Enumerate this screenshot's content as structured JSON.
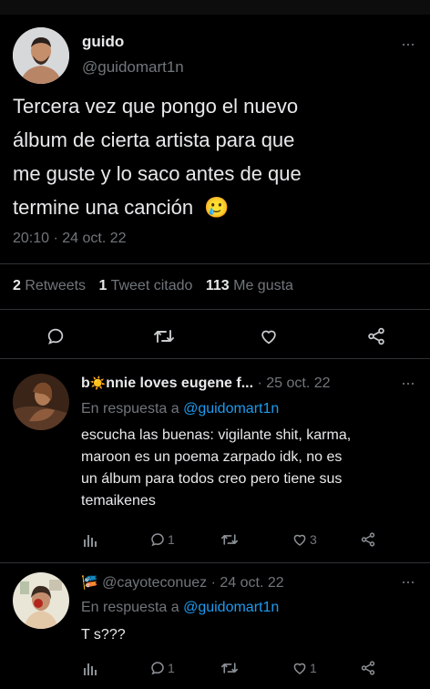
{
  "main_tweet": {
    "display_name": "guido",
    "handle": "@guidomart1n",
    "text_lines": [
      "Tercera vez que pongo el nuevo",
      "álbum de cierta artista para que",
      "me guste y lo saco antes de que",
      "termine una canción"
    ],
    "emoji": "🥲",
    "time": "20:10",
    "date": "24 oct. 22",
    "stats": {
      "retweets_count": "2",
      "retweets_label": "Retweets",
      "quotes_count": "1",
      "quotes_label": "Tweet citado",
      "likes_count": "113",
      "likes_label": "Me gusta"
    }
  },
  "replies": [
    {
      "display_name_prefix": "b",
      "display_name_emoji": "☀️",
      "display_name_rest": "nnie loves eugene f...",
      "date": "25 oct. 22",
      "reply_to_label": "En respuesta a",
      "reply_to_handle": "@guidomart1n",
      "text_lines": [
        "escucha las buenas: vigilante shit, karma,",
        "maroon es un poema zarpado idk, no es",
        "un álbum para todos creo pero tiene sus",
        "temaikenes"
      ],
      "reply_count": "1",
      "retweet_count": "",
      "like_count": "3"
    },
    {
      "name_emoji": "🎏",
      "handle": "@cayoteconuez",
      "date": "24 oct. 22",
      "reply_to_label": "En respuesta a",
      "reply_to_handle": "@guidomart1n",
      "text_lines": [
        "T s???"
      ],
      "reply_count": "1",
      "retweet_count": "",
      "like_count": "1"
    }
  ],
  "colors": {
    "background": "#000000",
    "text": "#e7e9ea",
    "muted": "#71767b",
    "accent": "#1d9bf0",
    "divider": "#2f3336"
  }
}
